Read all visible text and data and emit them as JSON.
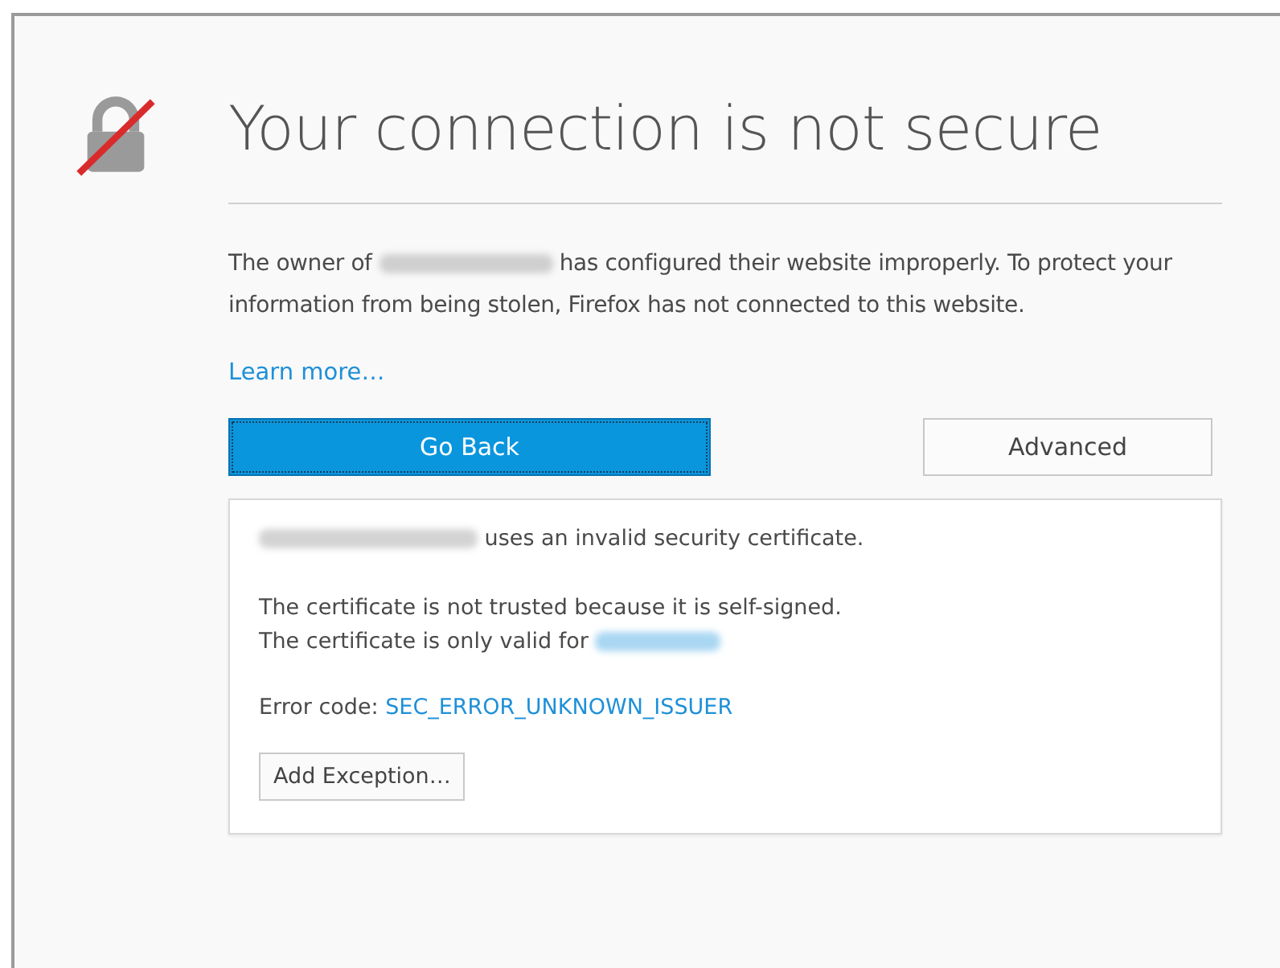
{
  "title": "Your connection is not secure",
  "intro": {
    "before": "The owner of",
    "redacted": true,
    "after": "has configured their website improperly. To protect your information from being stolen, Firefox has not connected to this website."
  },
  "learn_more": "Learn more…",
  "buttons": [
    {
      "label": "Go Back",
      "kind": "primary"
    },
    {
      "label": "Advanced",
      "kind": "secondary"
    }
  ],
  "advanced_panel": {
    "site_line": {
      "redacted": true,
      "after": "uses an invalid security certificate."
    },
    "reasons": [
      {
        "text": "The certificate is not trusted because it is self-signed.",
        "redacted_link": false
      },
      {
        "text": "The certificate is only valid for",
        "redacted_link": true
      }
    ],
    "error_label": "Error code:",
    "error_code": "SEC_ERROR_UNKNOWN_ISSUER",
    "exception_button": "Add Exception…"
  }
}
